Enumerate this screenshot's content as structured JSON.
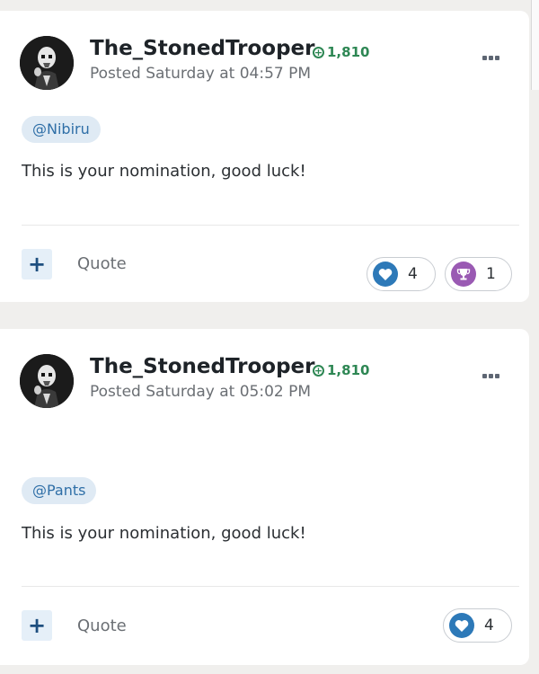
{
  "colors": {
    "page_background": "#f0efed",
    "reputation_green": "#2e8754",
    "mention_background": "#dfeaf4",
    "mention_text": "#2f6fa7",
    "like_blue": "#2d79b8",
    "trophy_purple": "#9a5ab3"
  },
  "posts": [
    {
      "author": "The_StonedTrooper",
      "reputation": "1,810",
      "posted": "Posted Saturday at 04:57 PM",
      "mention": "@Nibiru",
      "body": "This is your nomination, good luck!",
      "plus_label": "+",
      "quote_label": "Quote",
      "reactions": [
        {
          "icon": "heart-icon",
          "count": "4"
        },
        {
          "icon": "trophy-icon",
          "count": "1"
        }
      ]
    },
    {
      "author": "The_StonedTrooper",
      "reputation": "1,810",
      "posted": "Posted Saturday at 05:02 PM",
      "mention": "@Pants",
      "body": "This is your nomination, good luck!",
      "plus_label": "+",
      "quote_label": "Quote",
      "reactions": [
        {
          "icon": "heart-icon",
          "count": "4"
        }
      ]
    }
  ]
}
